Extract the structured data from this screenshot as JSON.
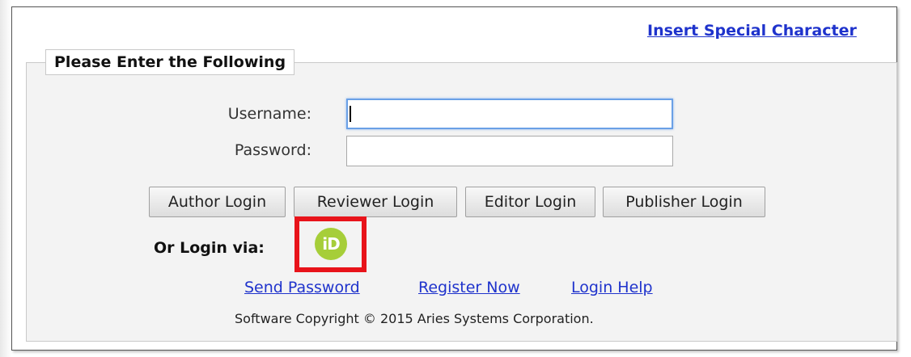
{
  "header": {
    "special_char_link": "Insert Special Character"
  },
  "form": {
    "legend": "Please Enter the Following",
    "username_label": "Username:",
    "username_value": "",
    "password_label": "Password:",
    "password_value": ""
  },
  "buttons": {
    "author": "Author Login",
    "reviewer": "Reviewer Login",
    "editor": "Editor Login",
    "publisher": "Publisher Login"
  },
  "alt_login": {
    "label": "Or Login via:",
    "provider_icon": "orcid-icon",
    "provider_icon_text": "iD",
    "provider_color": "#a6ce39",
    "highlight_color": "#e8131a"
  },
  "footer": {
    "links": [
      "Send Password",
      "Register Now",
      "Login Help"
    ],
    "copyright": "Software Copyright © 2015 Aries Systems Corporation."
  }
}
